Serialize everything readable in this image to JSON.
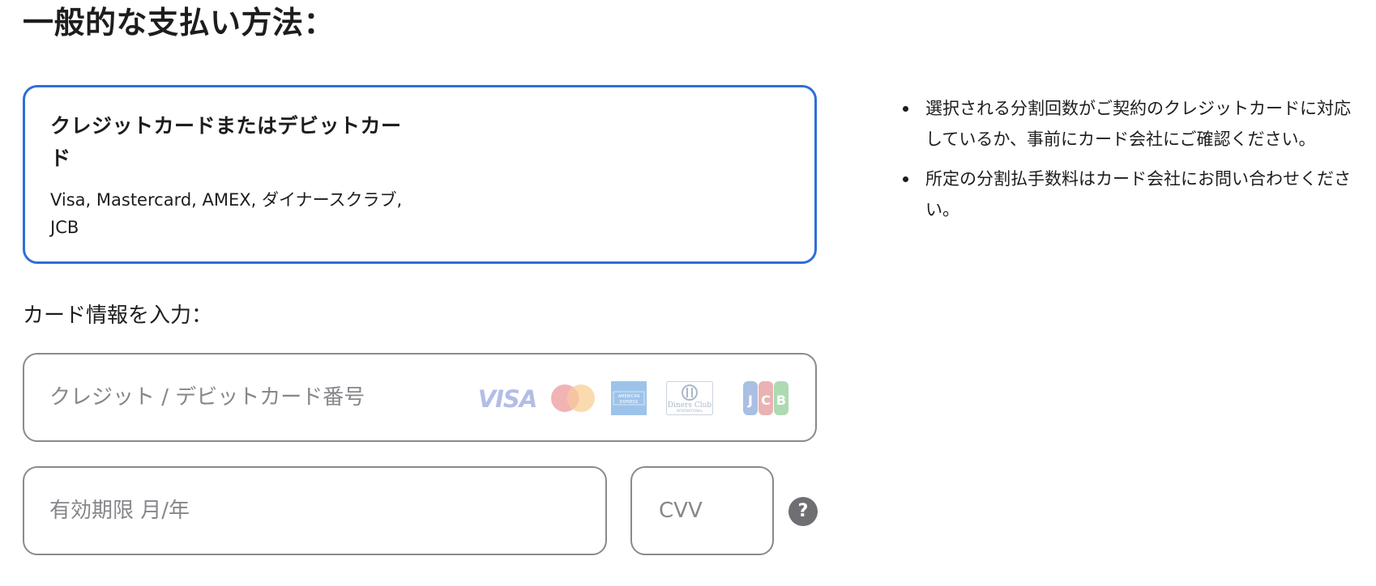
{
  "page_title": "一般的な支払い方法：",
  "payment_method": {
    "title": "クレジットカードまたはデビットカード",
    "subtitle": "Visa, Mastercard, AMEX, ダイナースクラブ, JCB",
    "selected": true,
    "accent_color": "#2f6fd6"
  },
  "notes": [
    "選択される分割回数がご契約のクレジットカードに対応しているか、事前にカード会社にご確認ください。",
    "所定の分割払手数料はカード会社にお問い合わせください。"
  ],
  "card_section": {
    "label": "カード情報を入力：",
    "card_number": {
      "placeholder": "クレジット / デビットカード番号",
      "value": ""
    },
    "brand_icons": [
      "visa-icon",
      "mastercard-icon",
      "amex-icon",
      "diners-club-icon",
      "jcb-icon"
    ],
    "expiry": {
      "placeholder": "有効期限 月/年",
      "value": ""
    },
    "cvv": {
      "placeholder": "CVV",
      "value": ""
    },
    "help_label": "?"
  }
}
